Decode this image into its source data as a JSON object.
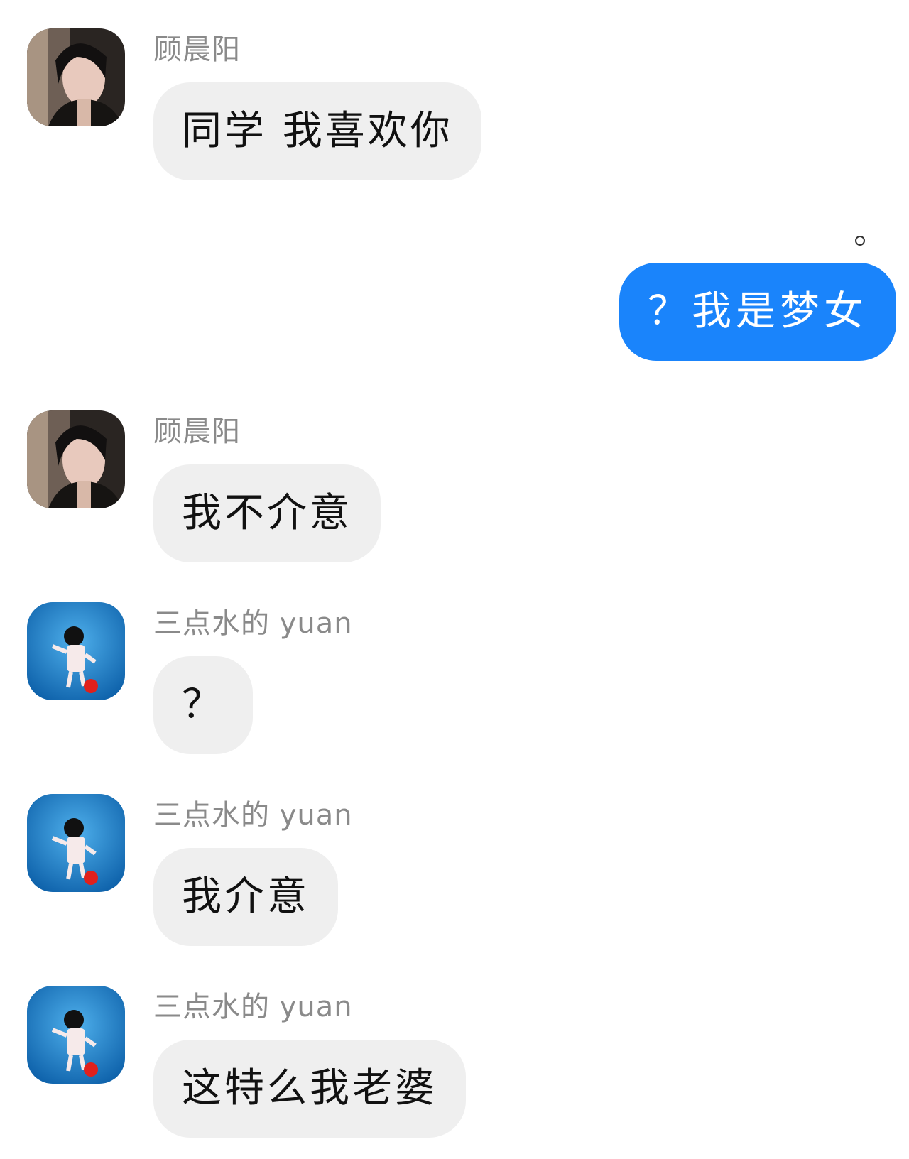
{
  "messages": [
    {
      "sender": "顾晨阳",
      "text": "同学 我喜欢你"
    },
    {
      "text": "？我是梦女"
    },
    {
      "sender": "顾晨阳",
      "text": "我不介意"
    },
    {
      "sender": "三点水的 yuan",
      "text": "？"
    },
    {
      "sender": "三点水的 yuan",
      "text": "我介意"
    },
    {
      "sender": "三点水的 yuan",
      "text": "这特么我老婆"
    }
  ],
  "colors": {
    "outgoing_bubble": "#1a84fb",
    "incoming_bubble": "#efefef",
    "sender_name": "#8a8a8a",
    "background": "#ffffff"
  },
  "icons": {
    "avatar_guchenyang": "portrait-avatar-icon",
    "avatar_yuan": "anime-character-avatar-icon",
    "sent_status": "sent-status-dot-icon"
  }
}
